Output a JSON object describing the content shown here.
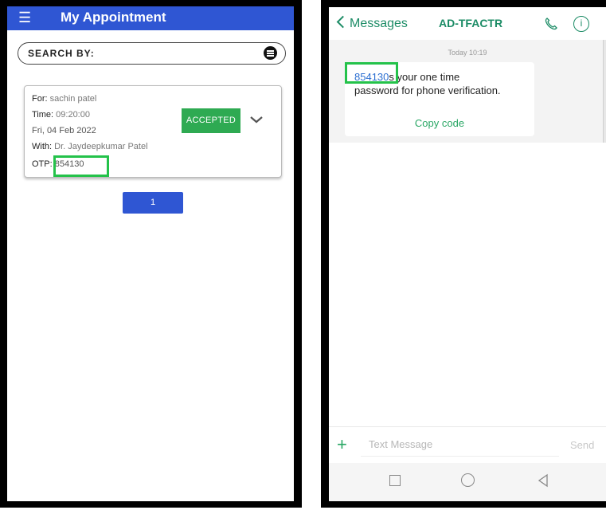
{
  "left": {
    "appbar": {
      "title": "My Appointment",
      "menu_icon": "menu-icon"
    },
    "search": {
      "label": "SEARCH BY:",
      "icon": "filter-icon"
    },
    "appointment": {
      "for_label": "For:",
      "for_value": "sachin patel",
      "time_label": "Time:",
      "time_value": "09:20:00",
      "date": "Fri, 04 Feb 2022",
      "with_label": "With:",
      "with_value": "Dr. Jaydeepkumar Patel",
      "otp_label": "OTP:",
      "otp_value": "854130",
      "status": "ACCEPTED",
      "expand_icon": "chevron-down-icon"
    },
    "pagination": {
      "page": "1"
    },
    "colors": {
      "primary": "#2f56d3",
      "accepted": "#2eaa52",
      "highlight": "#24c24a"
    }
  },
  "right": {
    "header": {
      "back_label": "Messages",
      "sender": "AD-TFACTR",
      "call_icon": "phone-icon",
      "info_icon": "info-icon",
      "info_glyph": "i"
    },
    "thread": {
      "timestamp": "Today 10:19",
      "code": "854130",
      "line1_rest": "s your one time",
      "line2": "password for phone verification.",
      "copy_label": "Copy code"
    },
    "composer": {
      "plus": "+",
      "placeholder": "Text Message",
      "send_label": "Send"
    },
    "navbar": {
      "icons": [
        "recent-apps-icon",
        "home-icon",
        "back-icon"
      ]
    },
    "colors": {
      "accent": "#1c8c66",
      "copy": "#2aa765",
      "code_link": "#2c6fd1"
    }
  }
}
